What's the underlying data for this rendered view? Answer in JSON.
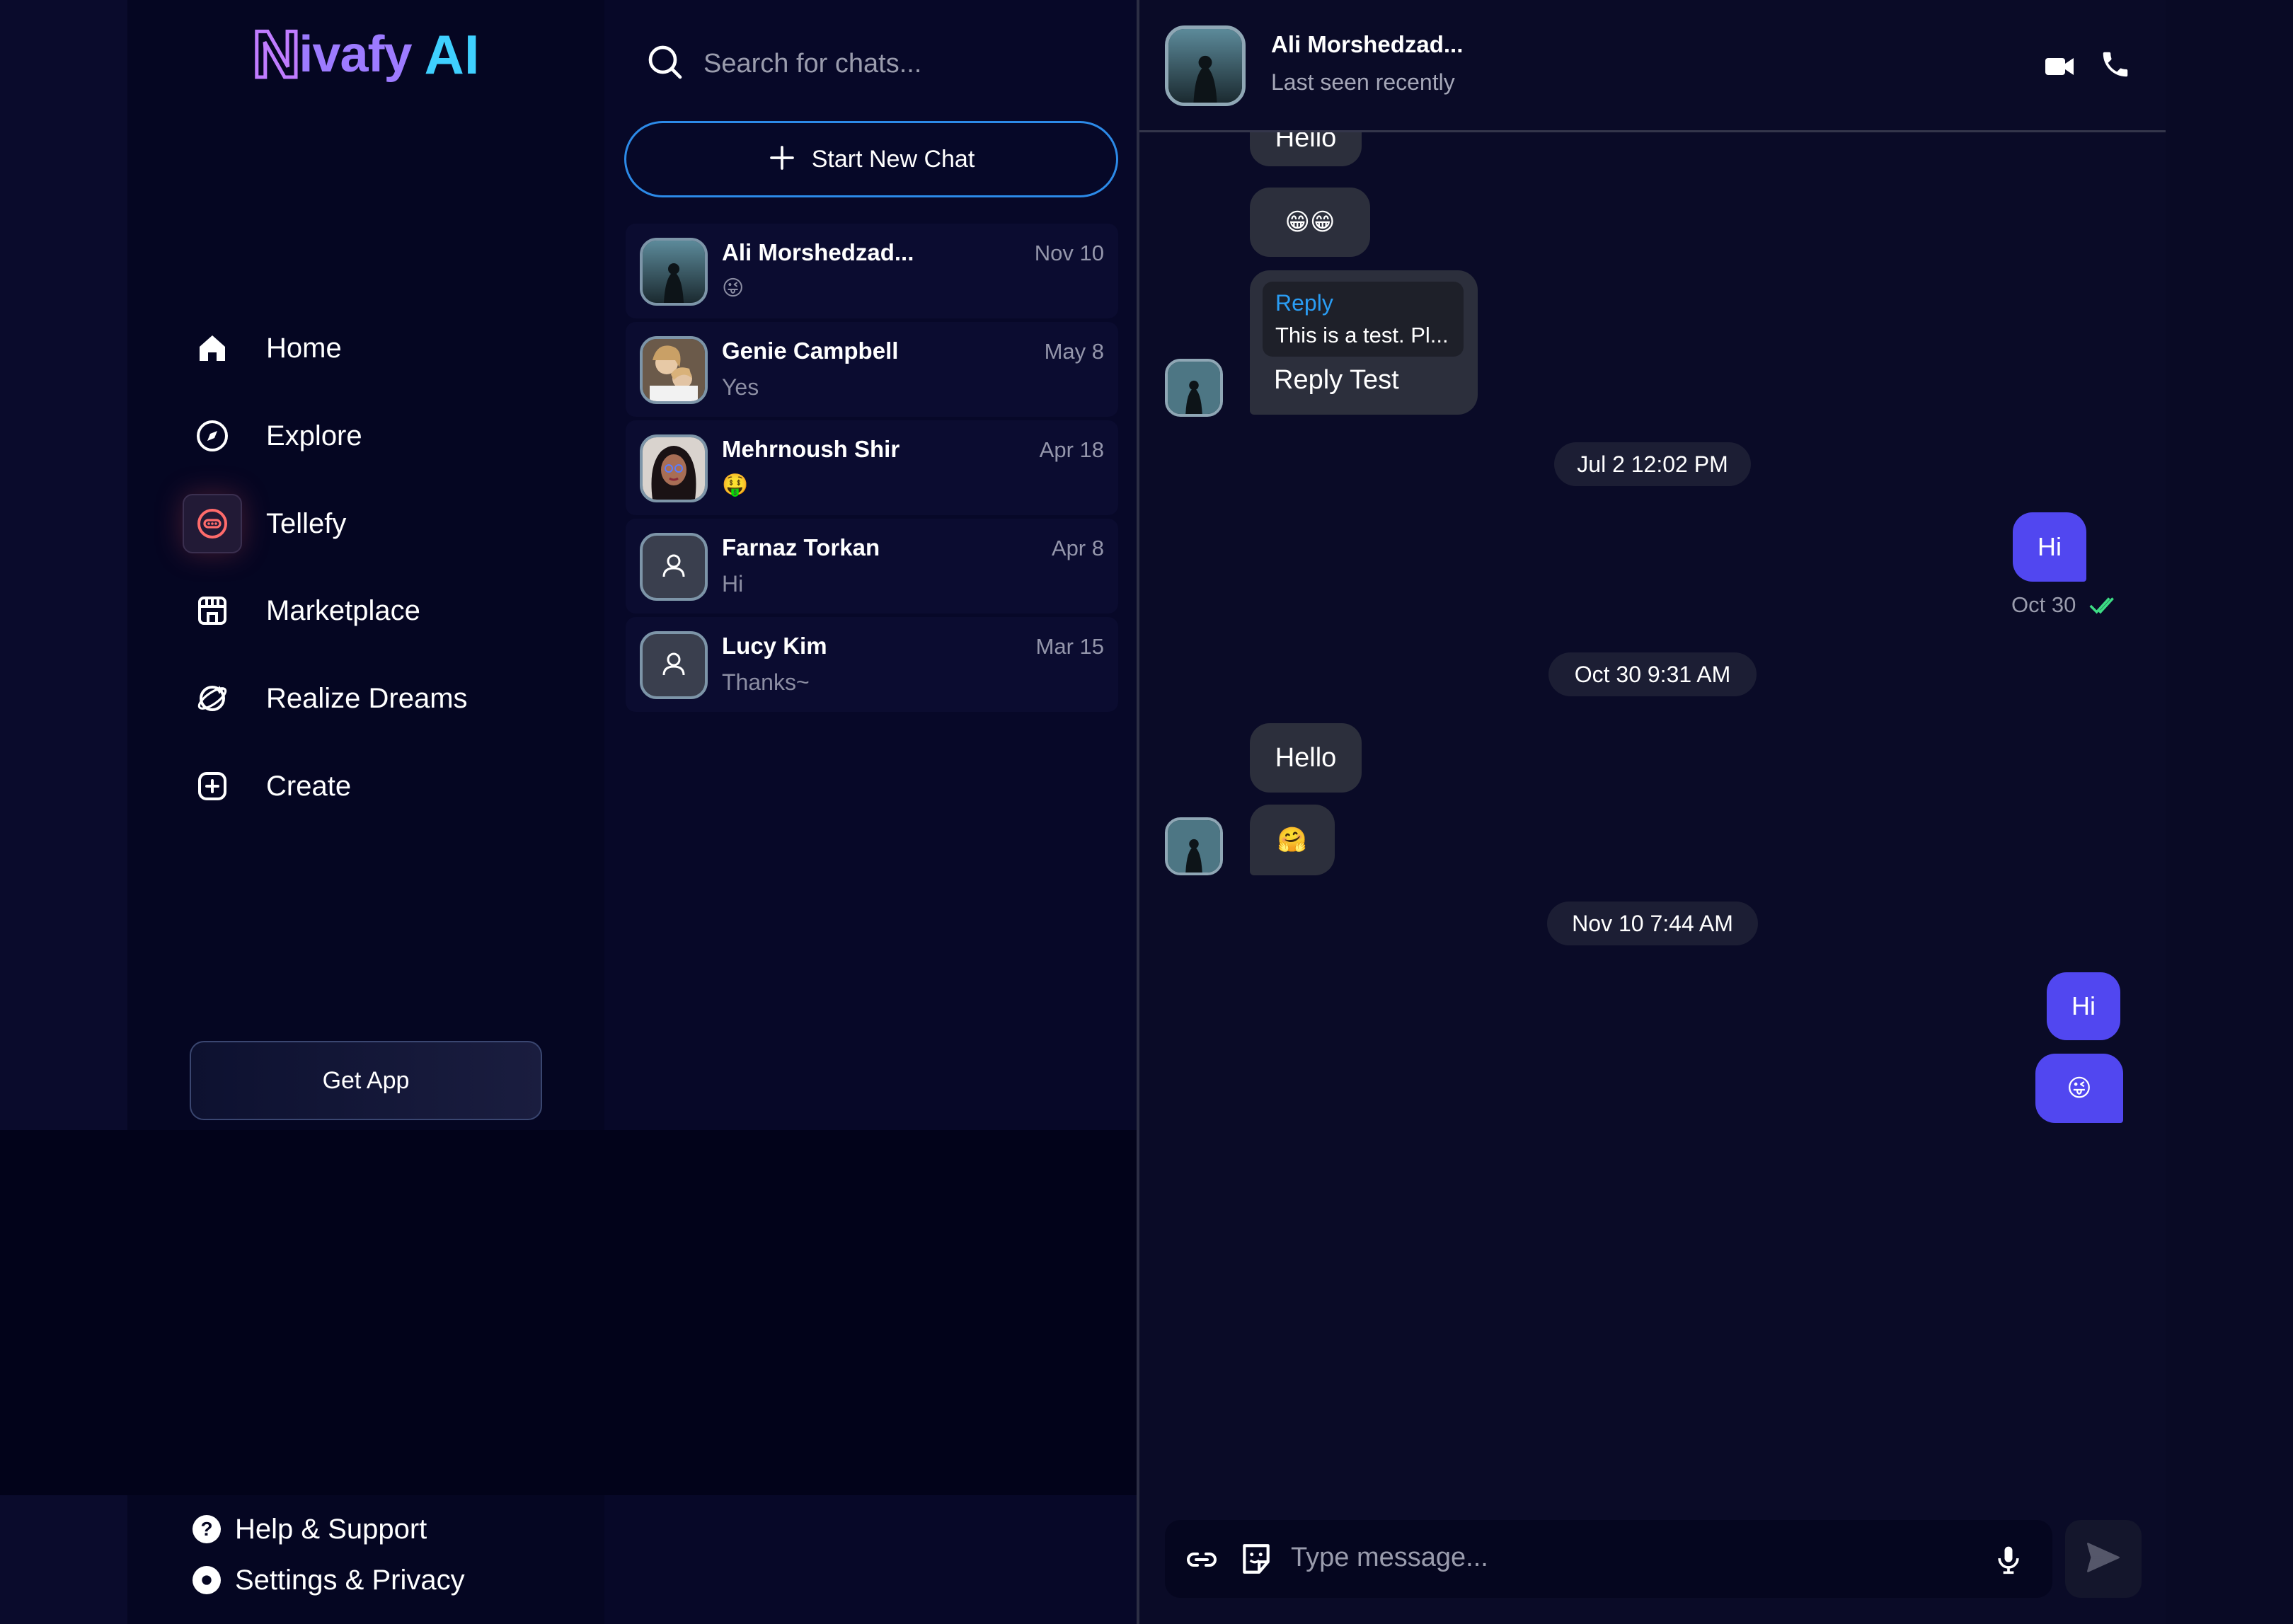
{
  "brand": {
    "logo_prefix": "N",
    "logo_name": "ivafy",
    "logo_suffix": "AI"
  },
  "nav": {
    "items": [
      {
        "label": "Home",
        "icon": "home-icon"
      },
      {
        "label": "Explore",
        "icon": "compass-icon"
      },
      {
        "label": "Tellefy",
        "icon": "chat-bubble-icon",
        "active": true
      },
      {
        "label": "Marketplace",
        "icon": "store-icon"
      },
      {
        "label": "Realize Dreams",
        "icon": "dream-icon"
      },
      {
        "label": "Create",
        "icon": "plus-square-icon"
      }
    ],
    "get_app": "Get App",
    "help": "Help & Support",
    "settings": "Settings & Privacy"
  },
  "chat_list": {
    "search_placeholder": "Search for chats...",
    "new_chat": "Start New Chat",
    "chats": [
      {
        "name": "Ali Morshedzad...",
        "date": "Nov 10",
        "preview": "😜"
      },
      {
        "name": "Genie Campbell",
        "date": "May 8",
        "preview": "Yes"
      },
      {
        "name": "Mehrnoush Shir",
        "date": "Apr 18",
        "preview": "🤑"
      },
      {
        "name": "Farnaz Torkan",
        "date": "Apr 8",
        "preview": "Hi"
      },
      {
        "name": "Lucy Kim",
        "date": "Mar 15",
        "preview": "Thanks~"
      }
    ]
  },
  "conversation": {
    "contact_name": "Ali Morshedzad...",
    "contact_status": "Last seen recently",
    "messages": {
      "hello_top": "Hello",
      "emoji_pair": "😁😁",
      "reply_label": "Reply",
      "reply_quote": "This is a test. Pl...",
      "reply_text": "Reply Test",
      "sep1": "Jul 2 12:02 PM",
      "out_hi_1": "Hi",
      "out_hi_1_time": "Oct 30",
      "sep2": "Oct 30 9:31 AM",
      "hello_2": "Hello",
      "hug": "🤗",
      "sep3": "Nov 10 7:44 AM",
      "out_hi_2": "Hi",
      "out_emoji": "😜"
    },
    "composer_placeholder": "Type message..."
  },
  "colors": {
    "accent_blue": "#2c8ae8",
    "outgoing_bubble": "#5147f0",
    "incoming_bubble": "#2c2f3c",
    "read_check": "#3ddc84",
    "reply_label": "#2a9df4"
  }
}
